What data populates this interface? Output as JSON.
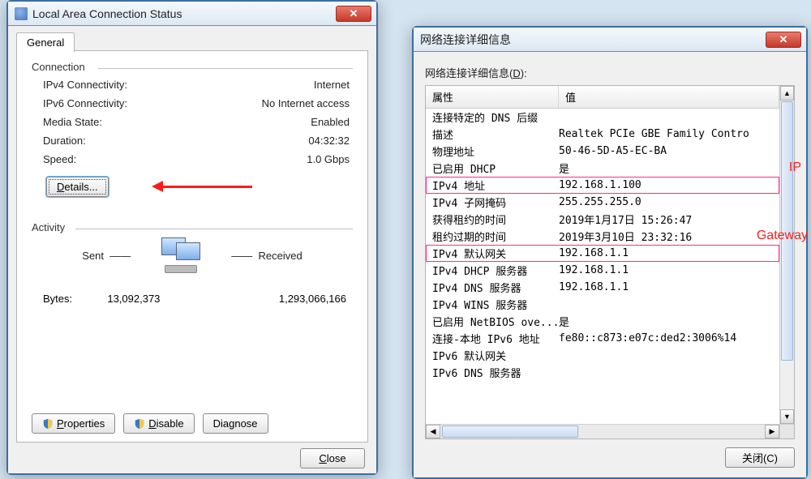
{
  "status_dialog": {
    "title": "Local Area Connection Status",
    "tab_general": "General",
    "connection": {
      "group_label": "Connection",
      "rows": [
        {
          "k": "IPv4 Connectivity:",
          "v": "Internet"
        },
        {
          "k": "IPv6 Connectivity:",
          "v": "No Internet access"
        },
        {
          "k": "Media State:",
          "v": "Enabled"
        },
        {
          "k": "Duration:",
          "v": "04:32:32"
        },
        {
          "k": "Speed:",
          "v": "1.0 Gbps"
        }
      ],
      "details_btn": "Details..."
    },
    "activity": {
      "group_label": "Activity",
      "sent_label": "Sent",
      "received_label": "Received",
      "bytes_label": "Bytes:",
      "bytes_sent": "13,092,373",
      "bytes_received": "1,293,066,166"
    },
    "buttons": {
      "properties": "Properties",
      "disable": "Disable",
      "diagnose": "Diagnose",
      "close": "Close"
    }
  },
  "details_dialog": {
    "title": "网络连接详细信息",
    "subtitle": "网络连接详细信息(D):",
    "header_prop": "属性",
    "header_val": "值",
    "rows": [
      {
        "prop": "连接特定的 DNS 后缀",
        "val": ""
      },
      {
        "prop": "描述",
        "val": "Realtek PCIe GBE Family Contro"
      },
      {
        "prop": "物理地址",
        "val": "50-46-5D-A5-EC-BA"
      },
      {
        "prop": "已启用 DHCP",
        "val": "是"
      },
      {
        "prop": "IPv4 地址",
        "val": "192.168.1.100",
        "highlight": true,
        "annotation": "IP"
      },
      {
        "prop": "IPv4 子网掩码",
        "val": "255.255.255.0"
      },
      {
        "prop": "获得租约的时间",
        "val": "2019年1月17日 15:26:47"
      },
      {
        "prop": "租约过期的时间",
        "val": "2019年3月10日 23:32:16"
      },
      {
        "prop": "IPv4 默认网关",
        "val": "192.168.1.1",
        "highlight": true,
        "annotation": "Gateway"
      },
      {
        "prop": "IPv4 DHCP 服务器",
        "val": "192.168.1.1"
      },
      {
        "prop": "IPv4 DNS 服务器",
        "val": "192.168.1.1"
      },
      {
        "prop": "IPv4 WINS 服务器",
        "val": ""
      },
      {
        "prop": "已启用 NetBIOS ove...",
        "val": "是"
      },
      {
        "prop": "连接-本地 IPv6 地址",
        "val": "fe80::c873:e07c:ded2:3006%14"
      },
      {
        "prop": "IPv6 默认网关",
        "val": ""
      },
      {
        "prop": "IPv6 DNS 服务器",
        "val": ""
      }
    ],
    "close_btn": "关闭(C)"
  }
}
